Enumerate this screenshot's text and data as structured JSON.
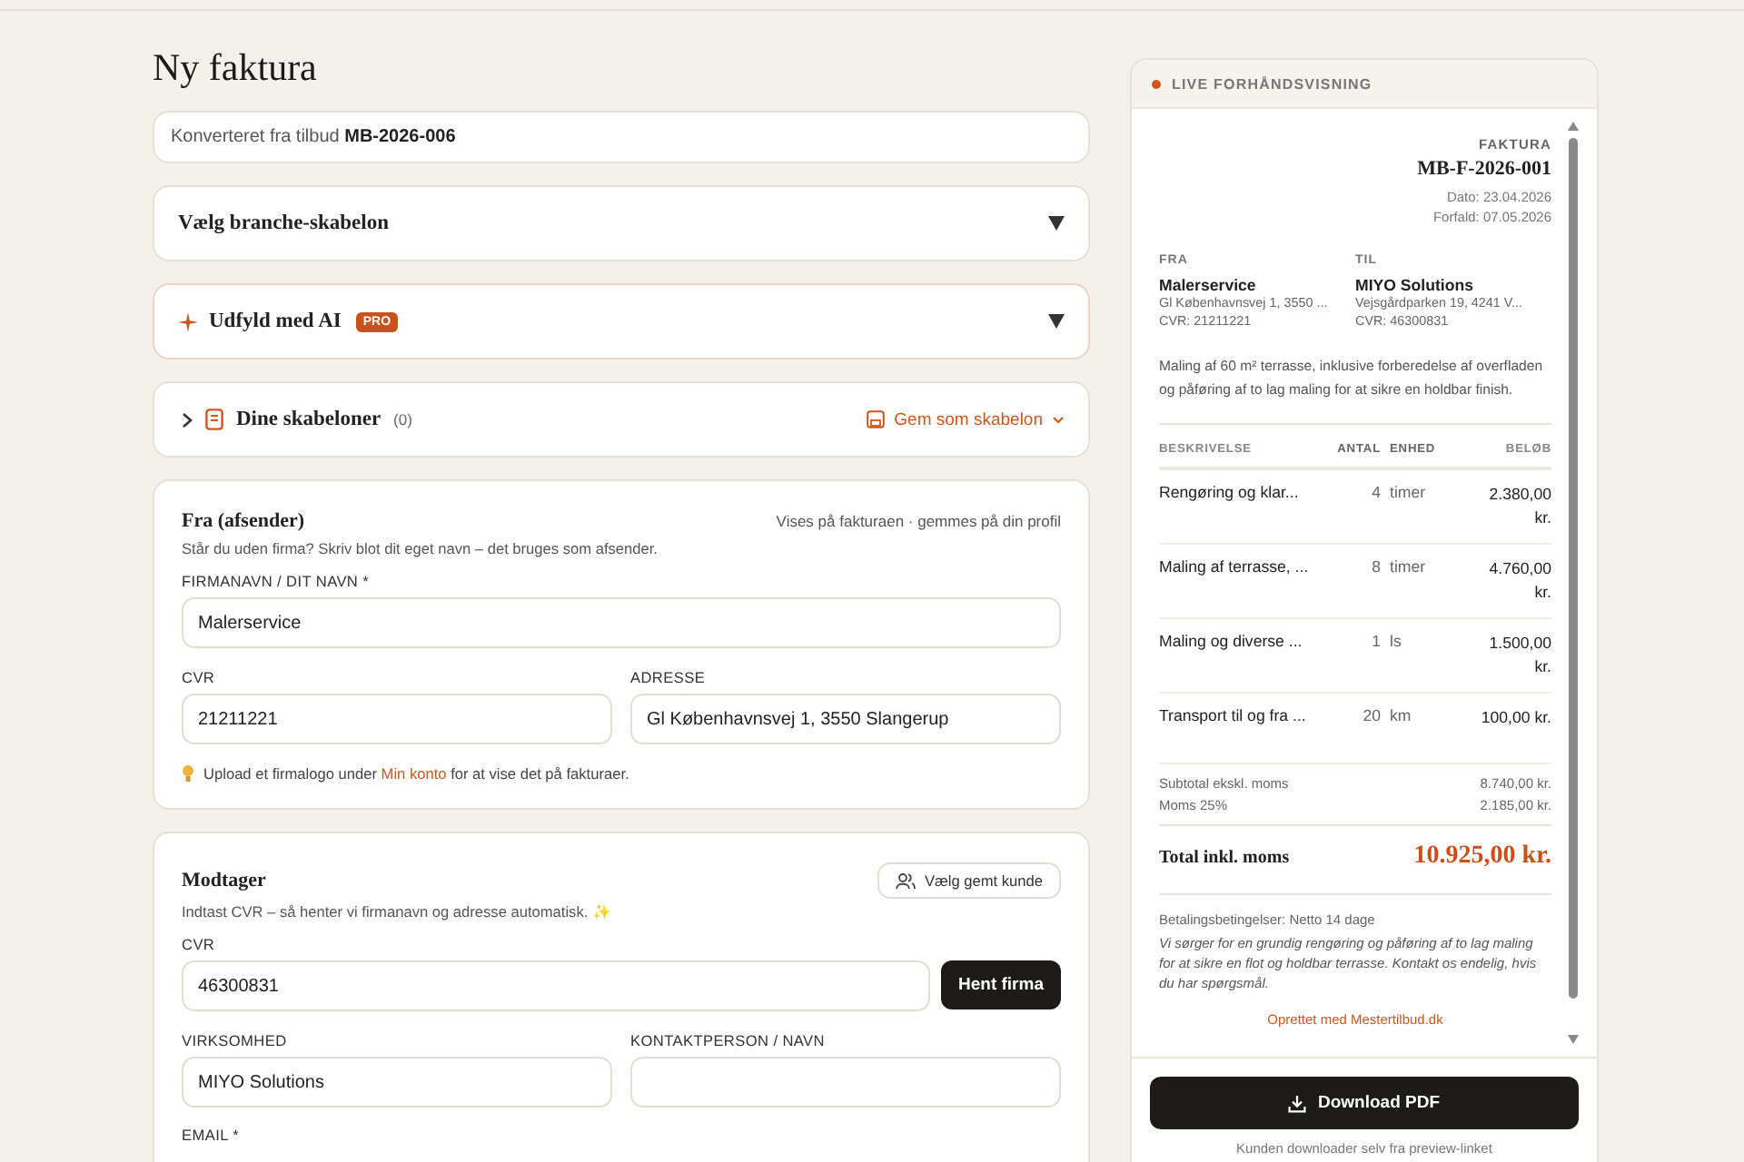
{
  "page_title": "Ny faktura",
  "conversion_note": "Konverteret fra tilbud **MB-2026-006**",
  "panels": [
    {
      "kind": "plain",
      "title": "Vælg branche-skabelon",
      "expanded": false
    },
    {
      "kind": "ai",
      "title": "Udfyld med AI",
      "badge": "PRO",
      "expanded": false
    }
  ],
  "templates": {
    "title": "Dine skabeloner",
    "count": "(0)",
    "expanded": false,
    "save_button": "Gem som skabelon"
  },
  "sender": {
    "title": "Fra (afsender)",
    "subtitle": "Vises på fakturaen · gemmes på din profil",
    "note": "Står du uden firma? Skriv blot dit eget navn – det bruges som afsender.",
    "fields": [
      {
        "label": "FIRMANAVN / DIT NAVN *",
        "value": "Malerservice"
      },
      {
        "label": "CVR",
        "value": "21211221"
      },
      {
        "label": "ADRESSE",
        "value": "Gl Københavnsvej 1, 3550 Slangerup"
      }
    ],
    "logo_hint_before": "Upload et firmalogo under",
    "logo_hint_link": "Min konto",
    "logo_hint_after": "for at vise det på fakturaer."
  },
  "recipient": {
    "title": "Modtager",
    "saved_customer_button": "Vælg gemt kunde",
    "note": "Indtast CVR – så henter vi firmanavn og adresse automatisk. ✨",
    "cvr_label": "CVR",
    "cvr_value": "46300831",
    "fetch_button": "Hent firma",
    "fields": [
      {
        "label": "VIRKSOMHED",
        "value": "MIYO Solutions"
      },
      {
        "label": "KONTAKTPERSON / NAVN"
      }
    ],
    "email_label": "EMAIL *"
  },
  "preview": {
    "header": "LIVE FORHÅNDSVISNING",
    "doc_type": "FAKTURA",
    "number": "MB-F-2026-001",
    "date": "Dato: 23.04.2026",
    "due": "Forfald: 07.05.2026",
    "parties": [
      {
        "label": "FRA",
        "name": "Malerservice",
        "address": "Gl Københavnsvej 1, 3550 ...",
        "cvr": "CVR: 21211221"
      },
      {
        "label": "TIL",
        "name": "MIYO Solutions",
        "address": "Vejsgårdparken 19, 4241 V...",
        "cvr": "CVR: 46300831"
      }
    ],
    "description": "Maling af 60 m² terrasse, inklusive forberedelse af overfladen og påføring af to lag maling for at sikre en holdbar finish.",
    "columns": [
      "BESKRIVELSE",
      "ANTAL",
      "ENHED",
      "BELØB"
    ],
    "rows": [
      {
        "description": "Rengøring og klar...",
        "qty": "4",
        "unit": "timer",
        "amount": "2.380,00 kr."
      },
      {
        "description": "Maling af terrasse, ...",
        "qty": "8",
        "unit": "timer",
        "amount": "4.760,00 kr."
      },
      {
        "description": "Maling og diverse ...",
        "qty": "1",
        "unit": "ls",
        "amount": "1.500,00 kr."
      },
      {
        "description": "Transport til og fra ...",
        "qty": "20",
        "unit": "km",
        "amount": "100,00 kr."
      }
    ],
    "subtotal_label": "Subtotal ekskl. moms",
    "subtotal": "8.740,00 kr.",
    "vat_label": "Moms 25%",
    "vat": "2.185,00 kr.",
    "total_label": "Total inkl. moms",
    "total": "10.925,00 kr.",
    "payment_terms": "Betalingsbetingelser: Netto 14 dage",
    "note": "Vi sørger for en grundig rengøring og påføring af to lag maling for at sikre en flot og holdbar terrasse. Kontakt os endelig, hvis du har spørgsmål.",
    "footer_link": "Oprettet med Mestertilbud.dk",
    "download_button": "Download PDF",
    "download_caption": "Kunden downloader selv fra preview-linket"
  }
}
